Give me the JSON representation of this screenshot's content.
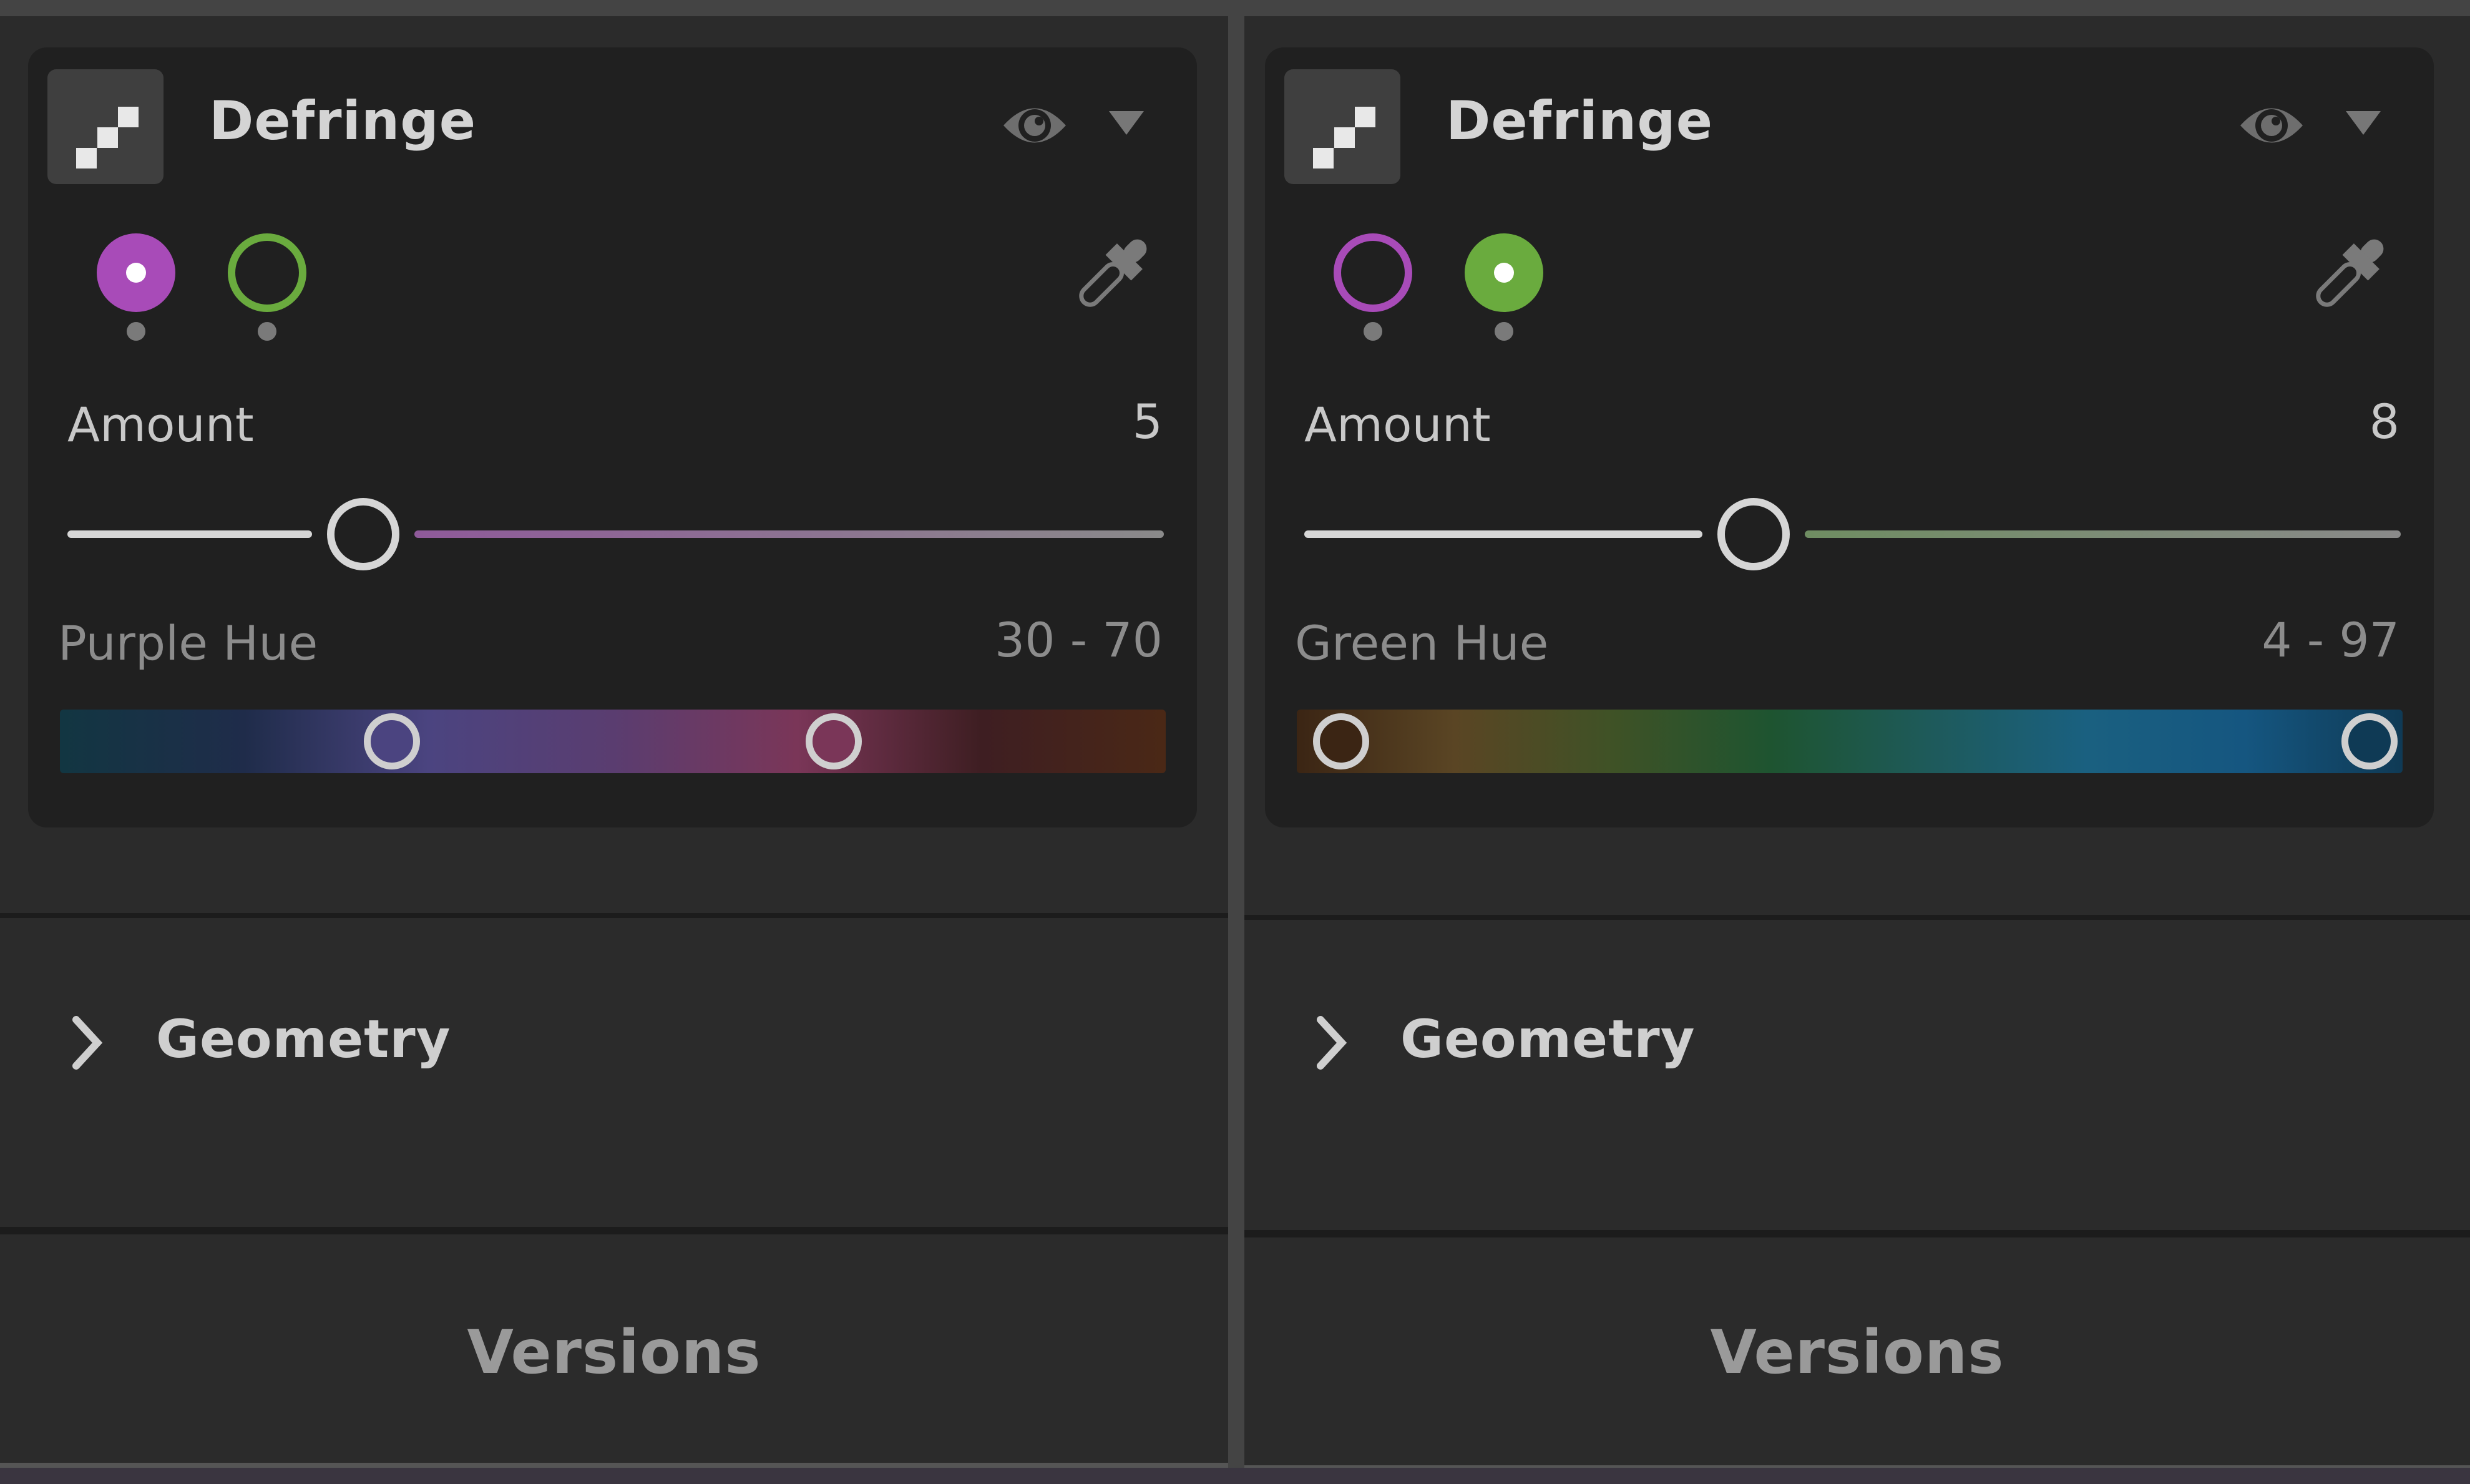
{
  "panels": [
    {
      "id": "left",
      "section_title": "Defringe",
      "swatches": [
        {
          "name": "purple",
          "color": "#a84bb8",
          "selected": true
        },
        {
          "name": "green",
          "color": "#6aab3e",
          "selected": false
        }
      ],
      "amount": {
        "label": "Amount",
        "value": "5",
        "fraction": 0.27,
        "accent_color": "#8f5a9a"
      },
      "hue": {
        "label": "Purple Hue",
        "value": "30 - 70",
        "range": [
          30,
          70
        ],
        "gradient": [
          "#123642",
          "#1f2c4a",
          "#4b4480",
          "#5a3d70",
          "#7a3658",
          "#3e1e22",
          "#4a2816"
        ]
      }
    },
    {
      "id": "right",
      "section_title": "Defringe",
      "swatches": [
        {
          "name": "purple",
          "color": "#a84bb8",
          "selected": false
        },
        {
          "name": "green",
          "color": "#6aab3e",
          "selected": true
        }
      ],
      "amount": {
        "label": "Amount",
        "value": "8",
        "fraction": 0.41,
        "accent_color": "#6f8d62"
      },
      "hue": {
        "label": "Green Hue",
        "value": "4 - 97",
        "range": [
          4,
          97
        ],
        "gradient": [
          "#3b2514",
          "#5a4524",
          "#3f5226",
          "#1e5430",
          "#1e5a5a",
          "#1a6080",
          "#155680",
          "#0f3a55"
        ]
      }
    }
  ],
  "geometry": {
    "label": "Geometry"
  },
  "versions": {
    "label": "Versions"
  },
  "icons": {
    "section_icon": "defringe-icon",
    "eye": "eye-icon",
    "menu": "caret-down-icon",
    "eyedropper": "eyedropper-icon",
    "expand": "chevron-right-icon"
  }
}
